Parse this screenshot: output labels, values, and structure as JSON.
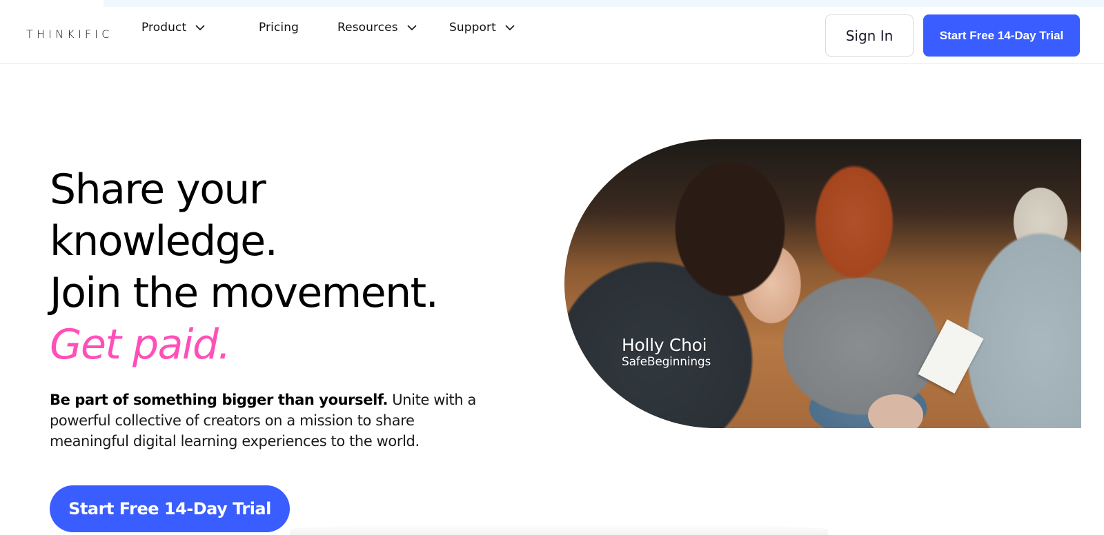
{
  "header": {
    "logo": "THINKIFIC",
    "nav": [
      {
        "label": "Product",
        "has_dropdown": true
      },
      {
        "label": "Pricing",
        "has_dropdown": false
      },
      {
        "label": "Resources",
        "has_dropdown": true
      },
      {
        "label": "Support",
        "has_dropdown": true
      }
    ],
    "sign_in_label": "Sign In",
    "trial_label": "Start Free 14-Day Trial"
  },
  "hero": {
    "title_lines": [
      "Share your",
      "knowledge.",
      "Join the movement."
    ],
    "title_accent": "Get paid.",
    "subtitle_bold": "Be part of something bigger than yourself.",
    "subtitle_rest": " Unite with a powerful collective of creators on a mission to share meaningful digital learning experiences to the world.",
    "cta_label": "Start Free 14-Day Trial",
    "image_caption": {
      "name": "Holly Choi",
      "organization": "SafeBeginnings"
    }
  },
  "colors": {
    "brand_blue": "#3a5dff",
    "accent_pink": "#ff4fb8"
  }
}
